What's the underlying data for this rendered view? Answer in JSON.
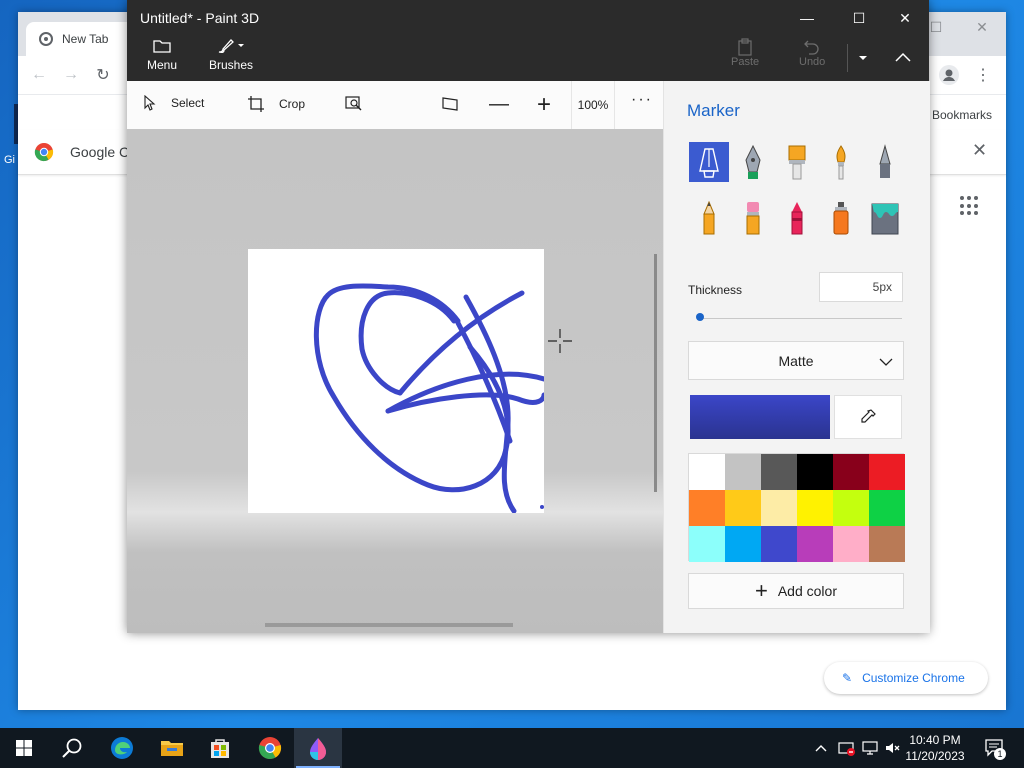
{
  "chrome": {
    "tab_title": "New Tab",
    "bookmarks_label": "Bookmarks",
    "notice_text": "Google Ch",
    "customize_label": "Customize Chrome",
    "desktop_label": "Gi"
  },
  "paint": {
    "title": "Untitled* - Paint 3D",
    "menu_label": "Menu",
    "brushes_label": "Brushes",
    "paste_label": "Paste",
    "undo_label": "Undo",
    "toolbar": {
      "select_label": "Select",
      "crop_label": "Crop",
      "zoom_value": "100%"
    },
    "panel": {
      "title": "Marker",
      "thickness_label": "Thickness",
      "thickness_value": "5px",
      "thickness_fraction": 0.0,
      "finish_value": "Matte",
      "add_color_label": "Add color",
      "current_color": "#3b46c8",
      "brushes": [
        {
          "name": "marker-brush-icon",
          "selected": true
        },
        {
          "name": "calligraphy-pen-icon",
          "selected": false
        },
        {
          "name": "oil-brush-icon",
          "selected": false
        },
        {
          "name": "watercolor-brush-icon",
          "selected": false
        },
        {
          "name": "pixel-pen-icon",
          "selected": false
        },
        {
          "name": "pencil-icon",
          "selected": false
        },
        {
          "name": "eraser-icon",
          "selected": false
        },
        {
          "name": "crayon-icon",
          "selected": false
        },
        {
          "name": "spray-can-icon",
          "selected": false
        },
        {
          "name": "fill-bucket-icon",
          "selected": false
        }
      ],
      "palette": [
        "#ffffff",
        "#c3c3c3",
        "#585858",
        "#000000",
        "#88001b",
        "#ec1c24",
        "#ff7f27",
        "#ffca18",
        "#fdeca6",
        "#fff200",
        "#c4ff0e",
        "#0ed145",
        "#8cfffb",
        "#00a8f3",
        "#3f48cc",
        "#b83dba",
        "#ffaec8",
        "#b97a56"
      ]
    }
  },
  "taskbar": {
    "time": "10:40 PM",
    "date": "11/20/2023",
    "notification_count": "1"
  }
}
